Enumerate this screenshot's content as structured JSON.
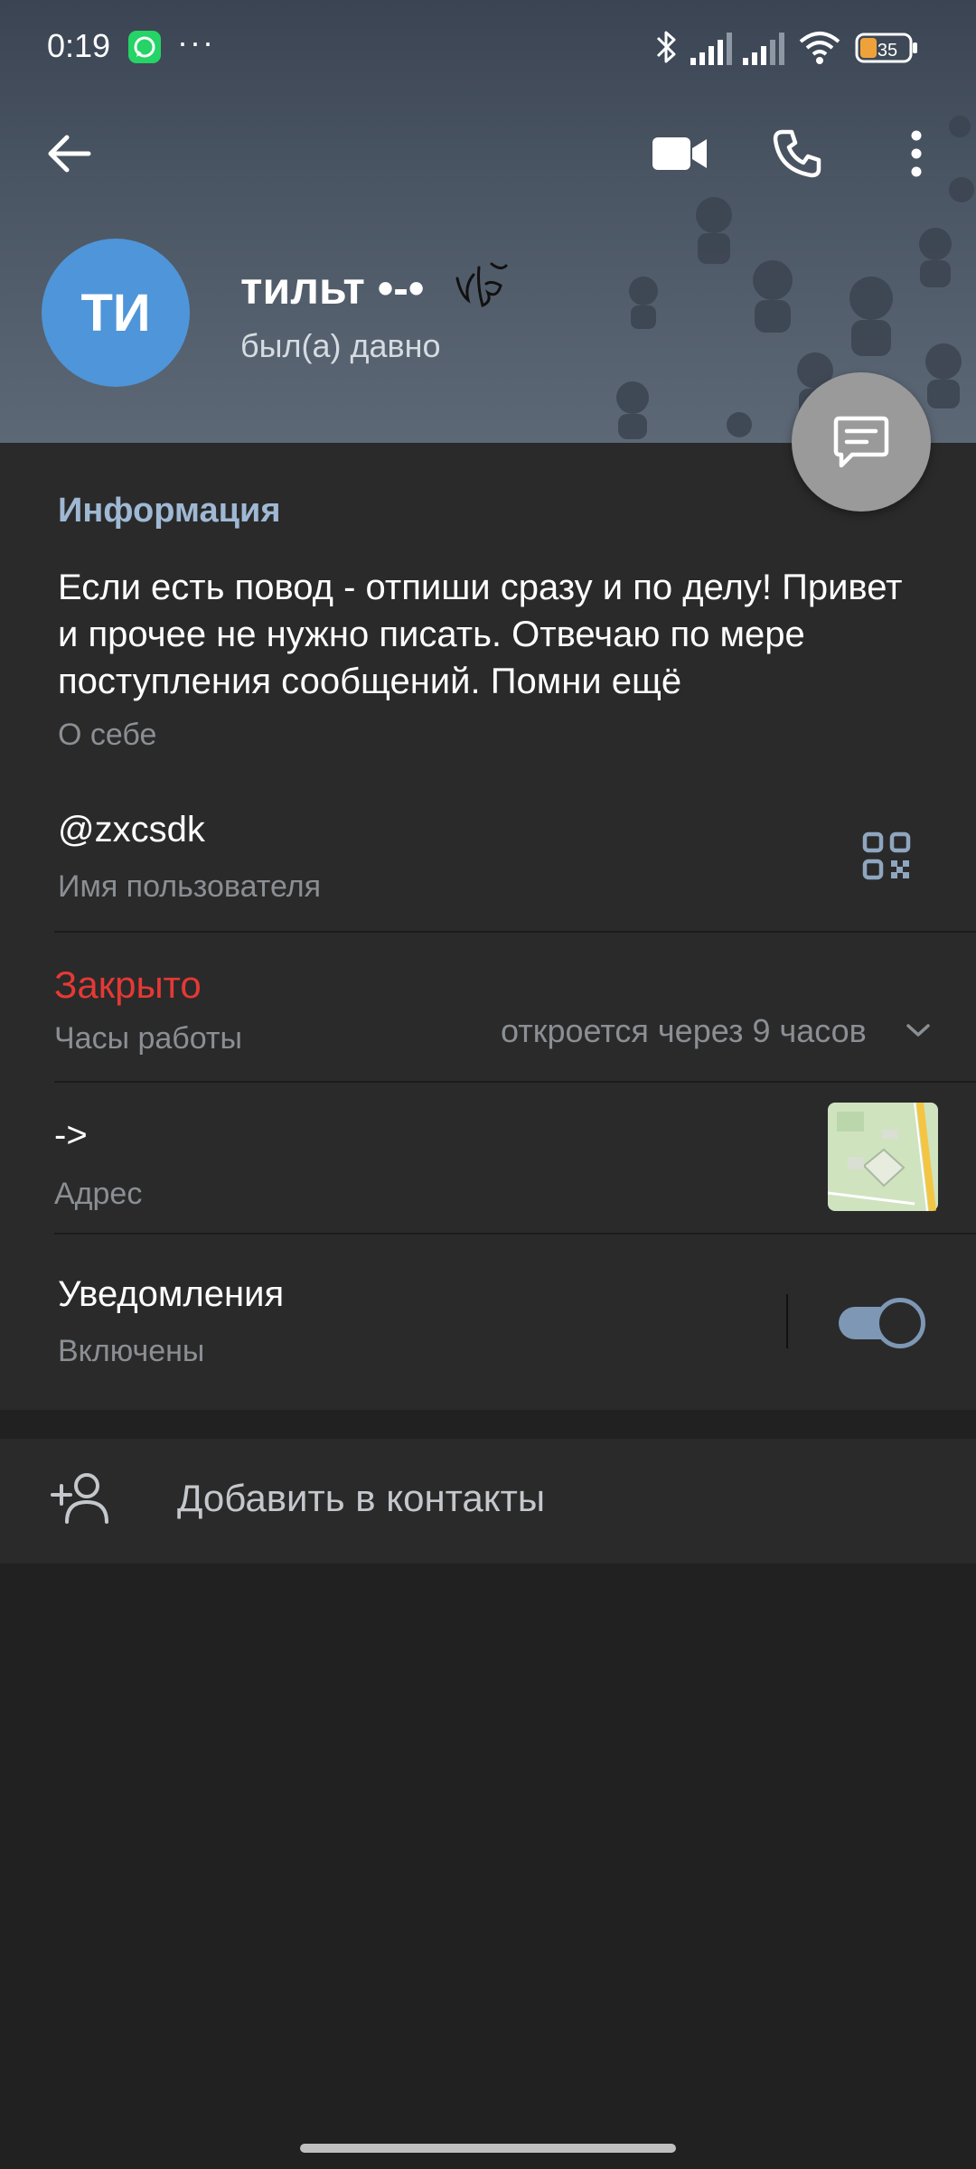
{
  "status_bar": {
    "time": "0:19",
    "overflow": "···",
    "battery": "35",
    "icons": [
      "whatsapp-icon",
      "bluetooth-icon",
      "signal-icon",
      "signal-icon",
      "wifi-icon",
      "battery-icon"
    ]
  },
  "toolbar": {
    "back_icon": "arrow-left-icon",
    "video_icon": "video-camera-icon",
    "call_icon": "phone-icon",
    "menu_icon": "more-vertical-icon"
  },
  "profile": {
    "initials": "ТИ",
    "name": "тильт •-•",
    "last_seen": "был(а) давно",
    "avatar_color": "#4f95d9"
  },
  "info": {
    "section_title": "Информация",
    "bio": "Если есть повод - отпиши сразу и по делу! Привет и прочее не нужно писать. Отвечаю по мере поступления сообщений. Помни ещё",
    "bio_label": "О себе",
    "username": "@zxcsdk",
    "username_label": "Имя пользователя",
    "hours_status": "Закрыто",
    "hours_label": "Часы работы",
    "hours_detail": "откроется через 9 часов",
    "address": "->",
    "address_label": "Адрес",
    "notifications": "Уведомления",
    "notifications_status": "Включены",
    "notifications_on": true
  },
  "actions": {
    "add_contact": "Добавить в контакты"
  },
  "colors": {
    "accent": "#9fb8d4",
    "closed": "#e53935",
    "toggle": "#7d97b5"
  }
}
